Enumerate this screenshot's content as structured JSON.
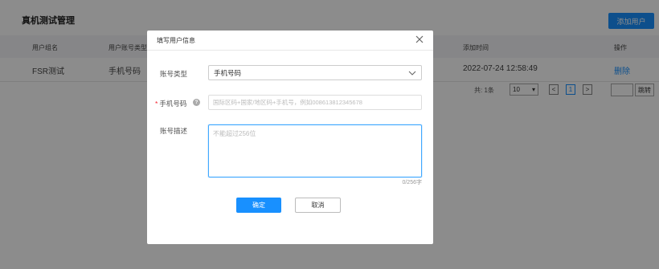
{
  "page": {
    "title": "真机测试管理",
    "add_user_label": "添加用户"
  },
  "table": {
    "headers": [
      "用户组名",
      "用户账号类型",
      "添加时间",
      "操作"
    ],
    "rows": [
      {
        "group_name": "FSR测试",
        "account_type": "手机号码",
        "added_time": "2022-07-24 12:58:49",
        "action": "删除"
      }
    ]
  },
  "pagination": {
    "total": "共: 1条",
    "page_size": "10",
    "prev": "<",
    "current": "1",
    "next": ">",
    "jump_label": "跳转"
  },
  "modal": {
    "title": "填写用户信息",
    "account_type_label": "账号类型",
    "account_type_value": "手机号码",
    "phone_label": "手机号码",
    "phone_required": "*",
    "help_icon": "?",
    "phone_placeholder": "国际区码+国家/地区码+手机号，例如008613812345678",
    "desc_label": "账号描述",
    "desc_placeholder": "不能超过256位",
    "counter": "0/256字",
    "ok_label": "确定",
    "cancel_label": "取消"
  },
  "colors": {
    "primary": "#1890ff",
    "danger": "#f5222d"
  }
}
